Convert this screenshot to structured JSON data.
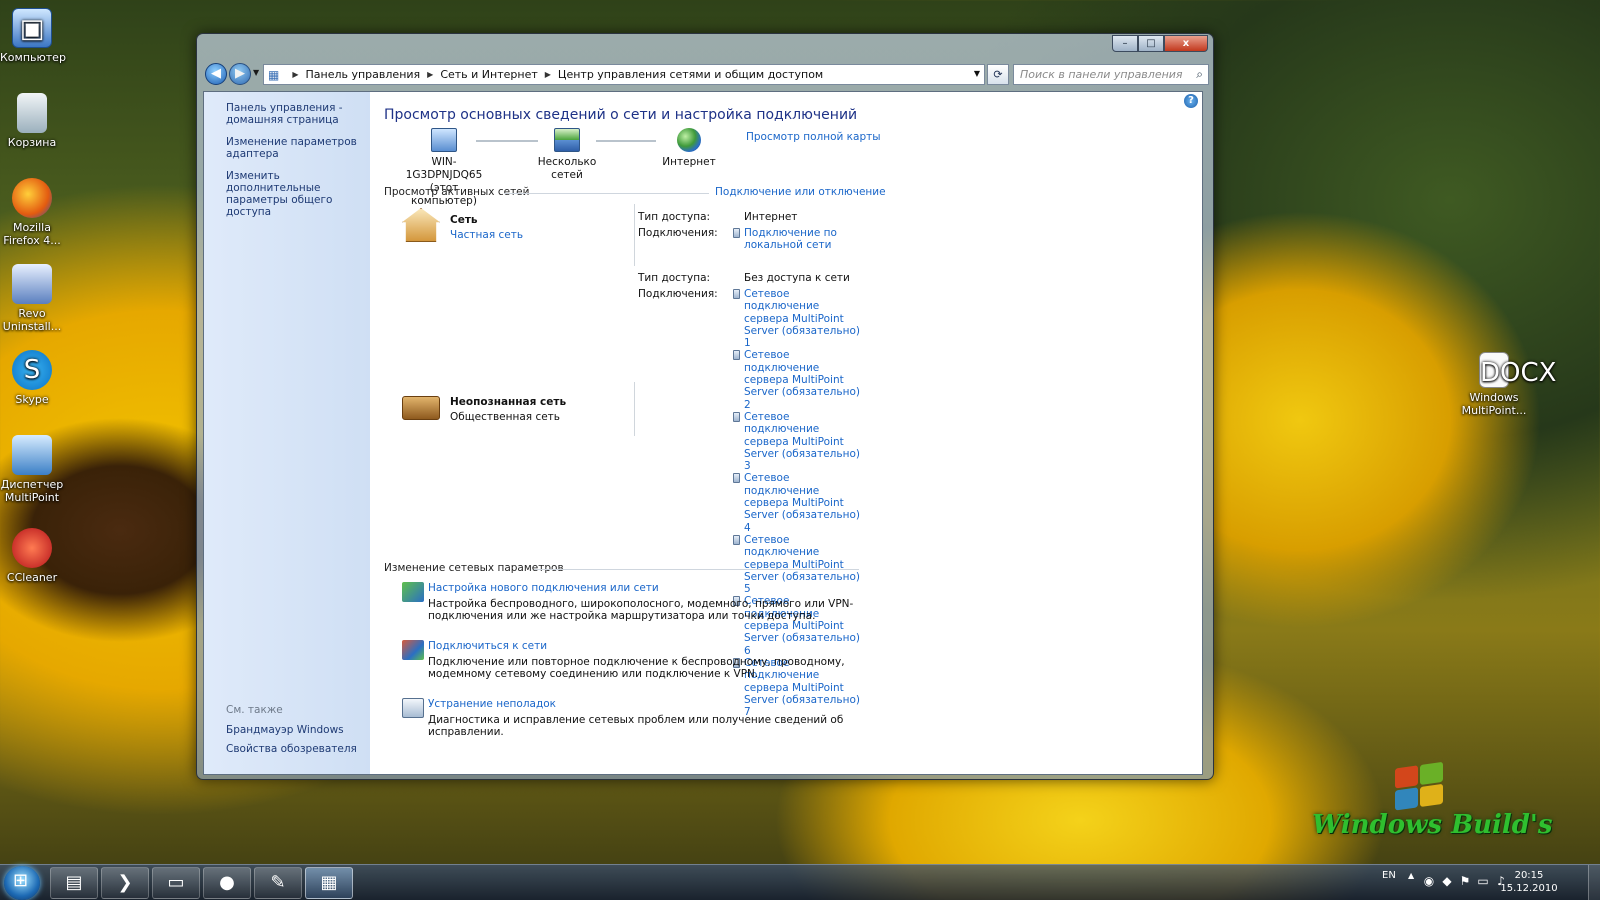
{
  "desktop": {
    "icons": [
      {
        "label": "Компьютер",
        "icon": "computer-icon"
      },
      {
        "label": "Корзина",
        "icon": "recycle-bin-icon"
      },
      {
        "label": "Mozilla Firefox 4...",
        "icon": "firefox-icon"
      },
      {
        "label": "Revo Uninstall...",
        "icon": "revo-uninstaller-icon"
      },
      {
        "label": "Skype",
        "icon": "skype-icon"
      },
      {
        "label": "Диспетчер MultiPoint",
        "icon": "multipoint-manager-icon"
      },
      {
        "label": "CCleaner",
        "icon": "ccleaner-icon"
      },
      {
        "label": "Windows MultiPoint...",
        "icon": "docx-file-icon"
      }
    ],
    "docx_badge": "DOCX",
    "wallpaper_logo": "Windows Build's"
  },
  "window": {
    "controls": {
      "minimize": "–",
      "maximize": "□",
      "close": "x"
    },
    "breadcrumb": [
      "Панель управления",
      "Сеть и Интернет",
      "Центр управления сетями и общим доступом"
    ],
    "search_placeholder": "Поиск в панели управления",
    "sidebar": {
      "links": [
        "Панель управления - домашняя страница",
        "Изменение параметров адаптера",
        "Изменить дополнительные параметры общего доступа"
      ],
      "see_also_heading": "См. также",
      "see_also": [
        "Брандмауэр Windows",
        "Свойства обозревателя"
      ]
    },
    "main": {
      "title": "Просмотр основных сведений о сети и настройка подключений",
      "full_map_link": "Просмотр полной карты",
      "map": {
        "computer_name": "WIN-1G3DPNJDQ65",
        "computer_sub": "(этот компьютер)",
        "middle": "Несколько сетей",
        "internet": "Интернет"
      },
      "active_heading": "Просмотр активных сетей",
      "connect_link": "Подключение или отключение",
      "networks": [
        {
          "name": "Сеть",
          "type": "Частная сеть",
          "access_label": "Тип доступа:",
          "access": "Интернет",
          "connections_label": "Подключения:",
          "connections": [
            "Подключение по локальной сети"
          ]
        },
        {
          "name": "Неопознанная сеть",
          "type": "Общественная сеть",
          "access_label": "Тип доступа:",
          "access": "Без доступа к сети",
          "connections_label": "Подключения:",
          "connections": [
            "Сетевое подключение сервера MultiPoint Server (обязательно) 1",
            "Сетевое подключение сервера MultiPoint Server (обязательно) 2",
            "Сетевое подключение сервера MultiPoint Server (обязательно) 3",
            "Сетевое подключение сервера MultiPoint Server (обязательно) 4",
            "Сетевое подключение сервера MultiPoint Server (обязательно) 5",
            "Сетевое подключение сервера MultiPoint Server (обязательно) 6",
            "Сетевое подключение сервера MultiPoint Server (обязательно) 7"
          ]
        }
      ],
      "change_heading": "Изменение сетевых параметров",
      "tasks": [
        {
          "title": "Настройка нового подключения или сети",
          "desc": "Настройка беспроводного, широкополосного, модемного, прямого или VPN-подключения или же настройка маршрутизатора или точки доступа."
        },
        {
          "title": "Подключиться к сети",
          "desc": "Подключение или повторное подключение к беспроводному, проводному, модемному сетевому соединению или подключение к VPN."
        },
        {
          "title": "Устранение неполадок",
          "desc": "Диагностика и исправление сетевых проблем или получение сведений об исправлении."
        }
      ]
    }
  },
  "taskbar": {
    "apps": [
      "server-manager-icon",
      "powershell-icon",
      "explorer-icon",
      "firefox-icon",
      "paint-icon",
      "network-center-icon"
    ],
    "lang": "EN",
    "time": "20:15",
    "date": "15.12.2010"
  },
  "colors": {
    "link": "#1a66c9",
    "title": "#1e3287",
    "sidebar": "#dfeafa"
  }
}
